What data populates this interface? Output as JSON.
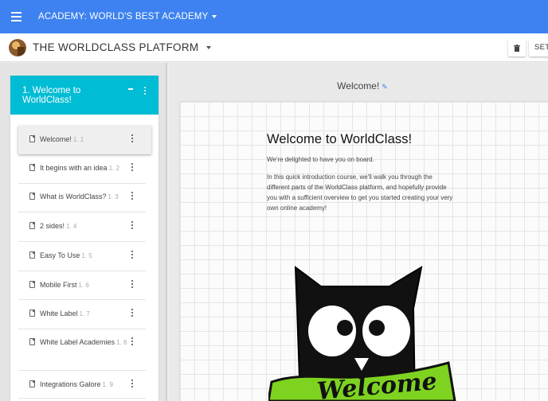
{
  "topbar": {
    "academy_label": "ACADEMY: WORLD'S BEST ACADEMY"
  },
  "subbar": {
    "platform_title": "THE WORLDCLASS PLATFORM",
    "settings_label": "SET"
  },
  "course": {
    "title": "1. Welcome to WorldClass!",
    "lessons": [
      {
        "label": "Welcome!",
        "number": "1. 1"
      },
      {
        "label": "It begins with an idea",
        "number": "1. 2"
      },
      {
        "label": "What is WorldClass?",
        "number": "1. 3"
      },
      {
        "label": "2 sides!",
        "number": "1. 4"
      },
      {
        "label": "Easy To Use",
        "number": "1. 5"
      },
      {
        "label": "Mobile First",
        "number": "1. 6"
      },
      {
        "label": "White Label",
        "number": "1. 7"
      },
      {
        "label": "White Label Academies",
        "number": "1. 8"
      },
      {
        "label": "Integrations Galore",
        "number": "1. 9"
      }
    ]
  },
  "lesson_view": {
    "header": "Welcome!",
    "heading": "Welcome to WorldClass!",
    "paragraph1": "We're delighted to have you on board.",
    "paragraph2": "In this quick introduction course, we'll walk you through the different parts of the WorldClass platform, and hopefully provide you with a sufficient overview to get you started creating your very own online academy!",
    "image_text": "Welcome"
  },
  "colors": {
    "topbar": "#3d82f0",
    "panel_header": "#00bcd4",
    "banner": "#7ed321"
  }
}
